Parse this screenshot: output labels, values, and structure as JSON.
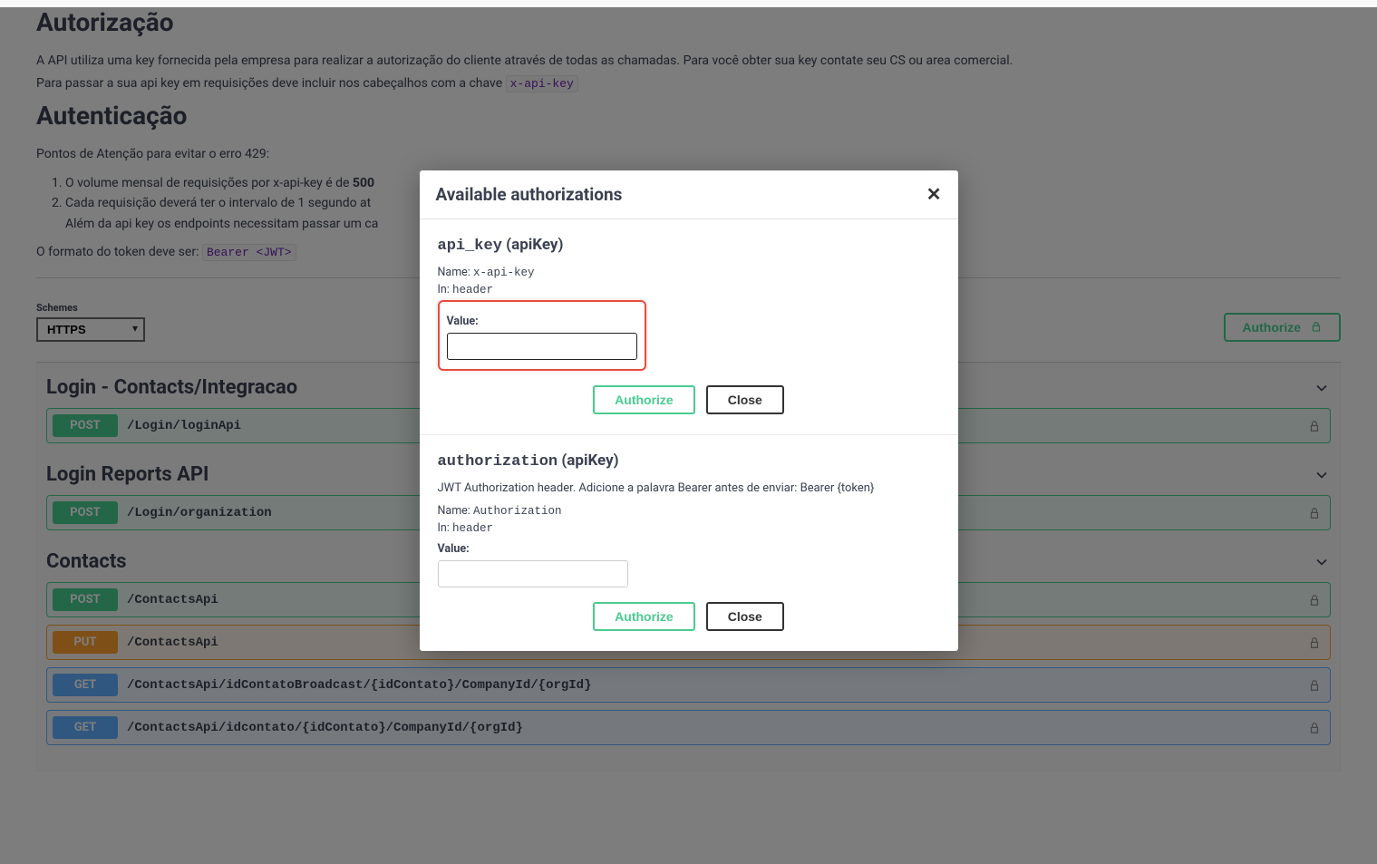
{
  "sections": {
    "auth_title": "Autorização",
    "auth_desc_1": "A API utiliza uma key fornecida pela empresa para realizar a autorização do cliente através de todas as chamadas. Para você obter sua key contate seu CS ou area comercial.",
    "auth_desc_2_prefix": "Para passar a sua api key em requisições deve incluir nos cabeçalhos com a chave ",
    "auth_desc_2_code": "x-api-key",
    "authn_title": "Autenticação",
    "attention_intro": "Pontos de Atenção para evitar o erro 429:",
    "attention_1_prefix": "O volume mensal de requisições por x-api-key é de ",
    "attention_1_bold": "500",
    "attention_2_line1": "Cada requisição deverá ter o intervalo de 1 segundo at",
    "attention_2_line2": "Além da api key os endpoints necessitam passar um ca",
    "format_prefix": "O formato do token deve ser: ",
    "format_code": "Bearer <JWT>"
  },
  "schemes": {
    "label": "Schemes",
    "selected": "HTTPS",
    "authorize_btn": "Authorize"
  },
  "tags": [
    {
      "title": "Login - Contacts/Integracao",
      "ops": [
        {
          "method": "POST",
          "cls": "post",
          "path": "/Login/loginApi"
        }
      ]
    },
    {
      "title": "Login Reports API",
      "ops": [
        {
          "method": "POST",
          "cls": "post",
          "path": "/Login/organization"
        }
      ]
    },
    {
      "title": "Contacts",
      "ops": [
        {
          "method": "POST",
          "cls": "post",
          "path": "/ContactsApi"
        },
        {
          "method": "PUT",
          "cls": "put",
          "path": "/ContactsApi"
        },
        {
          "method": "GET",
          "cls": "get",
          "path": "/ContactsApi/idContatoBroadcast/{idContato}/CompanyId/{orgId}"
        },
        {
          "method": "GET",
          "cls": "get",
          "path": "/ContactsApi/idcontato/{idContato}/CompanyId/{orgId}"
        }
      ]
    }
  ],
  "modal": {
    "title": "Available authorizations",
    "close_x": "✕",
    "blocks": [
      {
        "heading_key": "api_key",
        "heading_type": "(apiKey)",
        "desc": "",
        "name_label": "Name:",
        "name_value": "x-api-key",
        "in_label": "In:",
        "in_value": "header",
        "value_label": "Value:",
        "value": "",
        "highlighted": true,
        "authorize": "Authorize",
        "close": "Close"
      },
      {
        "heading_key": "authorization",
        "heading_type": "(apiKey)",
        "desc": "JWT Authorization header. Adicione a palavra Bearer antes de enviar: Bearer {token}",
        "name_label": "Name:",
        "name_value": "Authorization",
        "in_label": "In:",
        "in_value": "header",
        "value_label": "Value:",
        "value": "",
        "highlighted": false,
        "authorize": "Authorize",
        "close": "Close"
      }
    ]
  }
}
